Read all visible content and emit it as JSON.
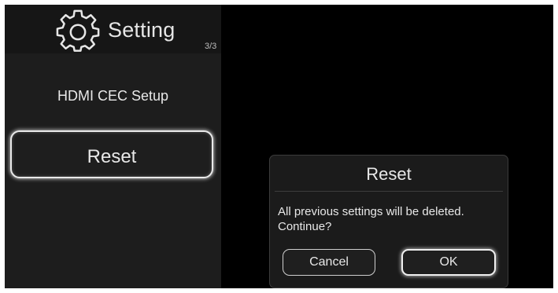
{
  "header": {
    "title": "Setting",
    "page_indicator": "3/3",
    "icon": "gear-icon"
  },
  "menu": {
    "items": [
      {
        "label": "HDMI CEC Setup",
        "selected": false
      },
      {
        "label": "Reset",
        "selected": true
      }
    ]
  },
  "dialog": {
    "title": "Reset",
    "message_line1": "All previous settings will be deleted.",
    "message_line2": "Continue?",
    "cancel_label": "Cancel",
    "ok_label": "OK",
    "focused_button": "OK"
  },
  "colors": {
    "screen_background": "#000000",
    "panel_background": "#1d1d1d",
    "text": "#e8e8e8",
    "focus_outline": "#f0f0f0"
  }
}
